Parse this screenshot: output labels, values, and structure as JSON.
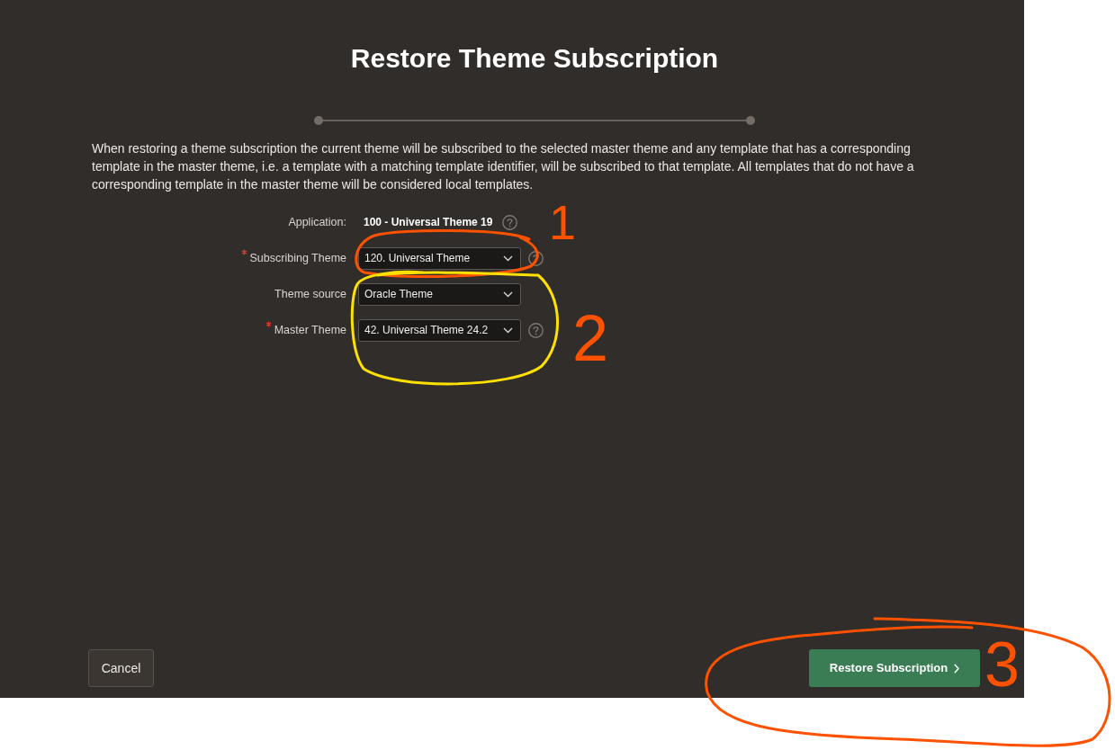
{
  "dialog": {
    "title": "Restore Theme Subscription",
    "description": "When restoring a theme subscription the current theme will be subscribed to the selected master theme and any template that has a corresponding template in the master theme, i.e. a template with a matching template identifier, will be subscribed to that template. All templates that do not have a corresponding template in the master theme will be considered local templates."
  },
  "form": {
    "fields": [
      {
        "kind": "display",
        "label": "Application:",
        "value": "100 - Universal Theme 19",
        "required": false,
        "help": true
      },
      {
        "kind": "select",
        "label": "Subscribing Theme",
        "value": "120. Universal Theme",
        "required": true,
        "help": true
      },
      {
        "kind": "select",
        "label": "Theme source",
        "value": "Oracle Theme",
        "required": false,
        "help": false
      },
      {
        "kind": "select",
        "label": "Master Theme",
        "value": "42. Universal Theme 24.2",
        "required": true,
        "help": true
      }
    ]
  },
  "buttons": [
    {
      "kind": "secondary",
      "label": "Cancel",
      "chevron": false
    },
    {
      "kind": "primary",
      "label": "Restore Subscription",
      "chevron": true
    }
  ],
  "annotations": [
    {
      "kind": "loop",
      "color": "#ff5200"
    },
    {
      "kind": "number",
      "label": "1",
      "color": "#ff5200"
    },
    {
      "kind": "loop",
      "color": "#ffe000"
    },
    {
      "kind": "number",
      "label": "2",
      "color": "#ff5200"
    },
    {
      "kind": "loop",
      "color": "#ff5200"
    },
    {
      "kind": "number",
      "label": "3",
      "color": "#ff5200"
    }
  ]
}
